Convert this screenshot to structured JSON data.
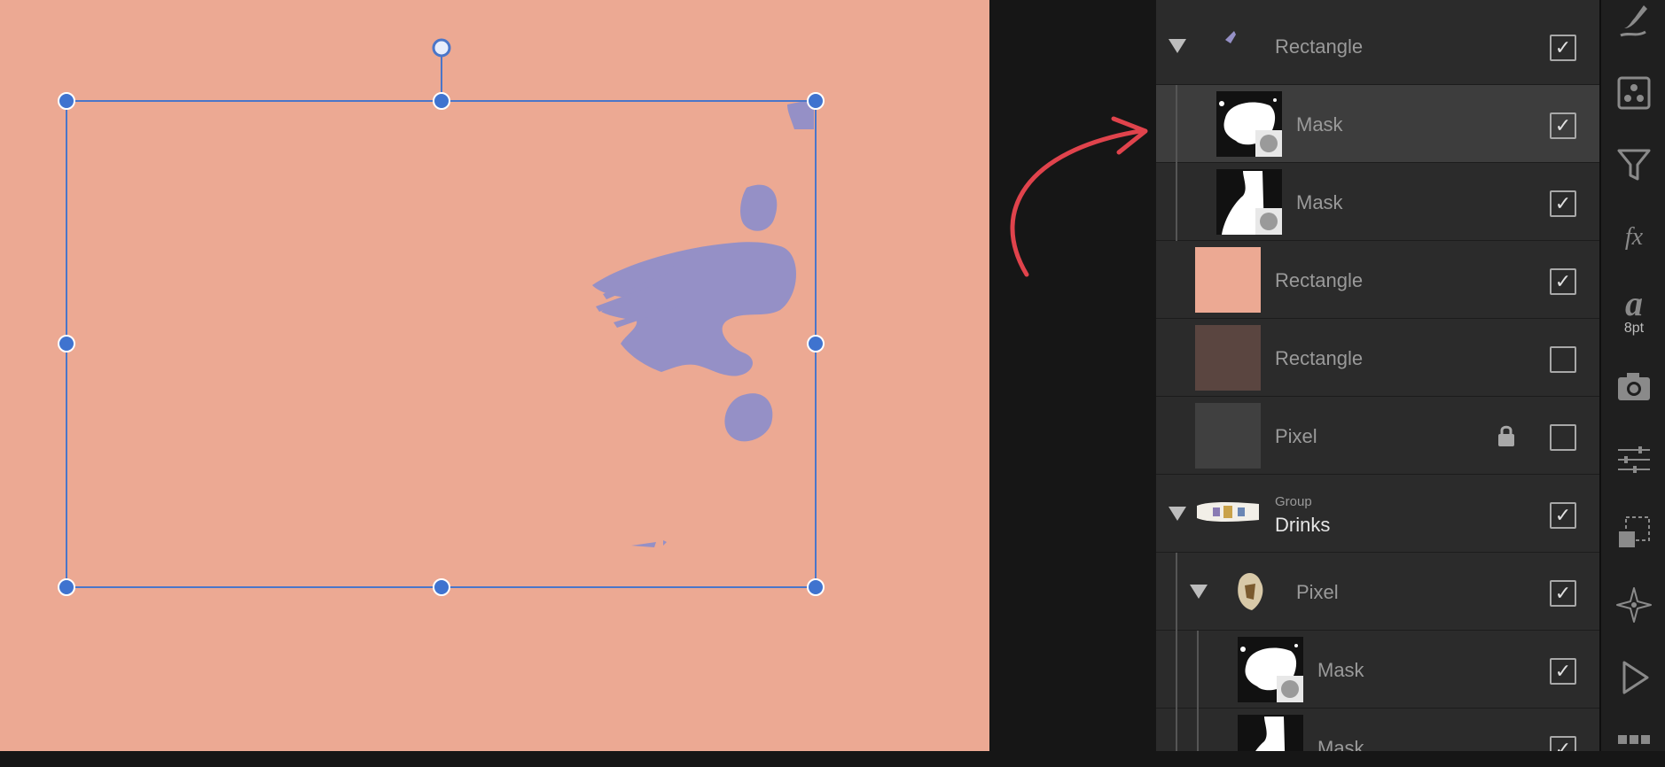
{
  "layers": [
    {
      "type": "Rectangle",
      "name": "",
      "checked": true,
      "expanded": true,
      "indent": 0,
      "selected": false,
      "locked": false
    },
    {
      "type": "Mask",
      "name": "",
      "checked": true,
      "expanded": null,
      "indent": 1,
      "selected": true,
      "locked": false
    },
    {
      "type": "Mask",
      "name": "",
      "checked": true,
      "expanded": null,
      "indent": 1,
      "selected": false,
      "locked": false
    },
    {
      "type": "Rectangle",
      "name": "",
      "checked": true,
      "expanded": null,
      "indent": 0,
      "selected": false,
      "locked": false
    },
    {
      "type": "Rectangle",
      "name": "",
      "checked": false,
      "expanded": null,
      "indent": 0,
      "selected": false,
      "locked": false
    },
    {
      "type": "Pixel",
      "name": "",
      "checked": false,
      "expanded": null,
      "indent": 0,
      "selected": false,
      "locked": true
    },
    {
      "type": "Group",
      "name": "Drinks",
      "checked": true,
      "expanded": true,
      "indent": 0,
      "selected": false,
      "locked": false
    },
    {
      "type": "Pixel",
      "name": "",
      "checked": true,
      "expanded": true,
      "indent": 1,
      "selected": false,
      "locked": false
    },
    {
      "type": "Mask",
      "name": "",
      "checked": true,
      "expanded": null,
      "indent": 2,
      "selected": false,
      "locked": false
    },
    {
      "type": "Mask",
      "name": "",
      "checked": true,
      "expanded": null,
      "indent": 2,
      "selected": false,
      "locked": false
    }
  ],
  "toolbar": {
    "character_size": "8pt"
  },
  "colors": {
    "canvas_bg": "#eca993",
    "shape_fill": "#9590c6",
    "selection": "#4a76c9",
    "annotation_arrow": "#e0434c",
    "panel_bg": "#2b2b2b",
    "selected_row": "#3d3d3d"
  },
  "icons": [
    "brush-icon",
    "swatches-icon",
    "filter-icon",
    "fx-icon",
    "character-icon",
    "camera-icon",
    "adjustments-icon",
    "transform-icon",
    "navigator-icon",
    "play-icon",
    "grid-icon"
  ]
}
